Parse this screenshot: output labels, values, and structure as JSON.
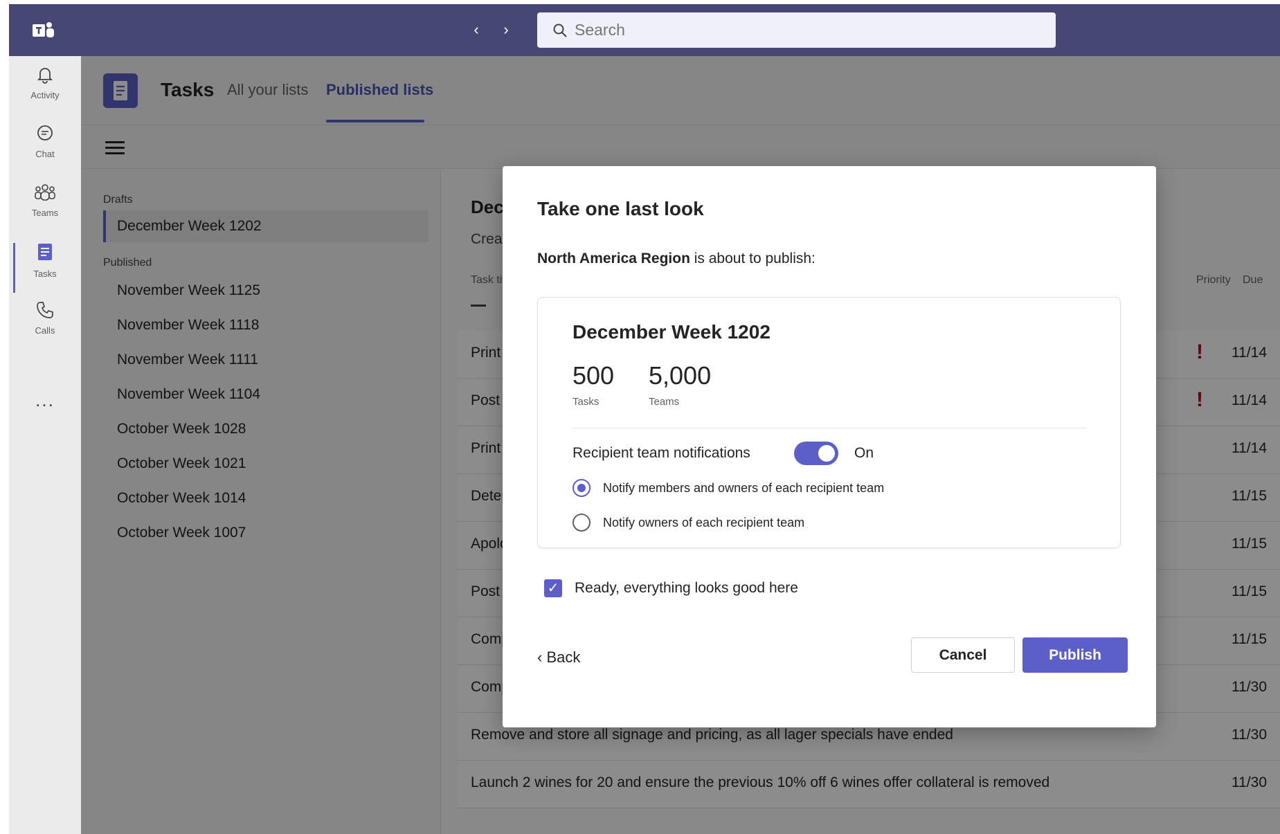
{
  "colors": {
    "brand_bar": "#464775",
    "accent": "#5b5fc7",
    "priority_red": "#b10e1c"
  },
  "topbar": {
    "search_placeholder": "Search",
    "back_icon": "chevron-left-icon",
    "forward_icon": "chevron-right-icon"
  },
  "rail": {
    "items": [
      {
        "label": "Activity",
        "icon": "bell-icon"
      },
      {
        "label": "Chat",
        "icon": "chat-icon"
      },
      {
        "label": "Teams",
        "icon": "teams-icon"
      },
      {
        "label": "Tasks",
        "icon": "tasks-icon"
      },
      {
        "label": "Calls",
        "icon": "phone-icon"
      }
    ],
    "more": "..."
  },
  "header": {
    "title": "Tasks",
    "tabs": [
      {
        "label": "All your lists"
      },
      {
        "label": "Published lists"
      }
    ]
  },
  "lists": {
    "drafts_label": "Drafts",
    "drafts": [
      "December Week 1202"
    ],
    "published_label": "Published",
    "published": [
      "November Week 1125",
      "November Week 1118",
      "November Week 1111",
      "November Week 1104",
      "October Week 1028",
      "October Week 1021",
      "October Week 1014",
      "October Week 1007"
    ]
  },
  "detail": {
    "title": "Dece",
    "subtitle": "Create",
    "columns": {
      "task": "Task tit",
      "priority": "Priority",
      "due": "Due"
    },
    "rows": [
      {
        "task": "Print a",
        "due": "11/14",
        "priority": "!"
      },
      {
        "task": "Post m",
        "due": "11/14",
        "priority": "!"
      },
      {
        "task": "Print n",
        "due": "11/14",
        "priority": ""
      },
      {
        "task": "Deterr",
        "due": "11/15",
        "priority": ""
      },
      {
        "task": "Apolo",
        "due": "11/15",
        "priority": ""
      },
      {
        "task": "Post n",
        "due": "11/15",
        "priority": ""
      },
      {
        "task": "Compl",
        "due": "11/15",
        "priority": ""
      },
      {
        "task": "Compl",
        "due": "11/30",
        "priority": ""
      },
      {
        "task": "Remove and store all signage and pricing, as all lager specials have ended",
        "due": "11/30",
        "priority": ""
      },
      {
        "task": "Launch 2 wines for 20 and ensure the previous 10% off 6 wines offer collateral is removed",
        "due": "11/30",
        "priority": ""
      }
    ]
  },
  "modal": {
    "title": "Take one last look",
    "publisher": "North America Region",
    "desc_suffix": " is about to publish:",
    "card": {
      "list_name": "December Week 1202",
      "tasks_count": "500",
      "tasks_label": "Tasks",
      "teams_count": "5,000",
      "teams_label": "Teams",
      "notif_label": "Recipient team notifications",
      "notif_state": "On",
      "option_1": "Notify members and owners of each recipient team",
      "option_2": "Notify owners of each recipient team"
    },
    "confirm_label": "Ready, everything looks good here",
    "back_label": "Back",
    "cancel_label": "Cancel",
    "publish_label": "Publish"
  }
}
